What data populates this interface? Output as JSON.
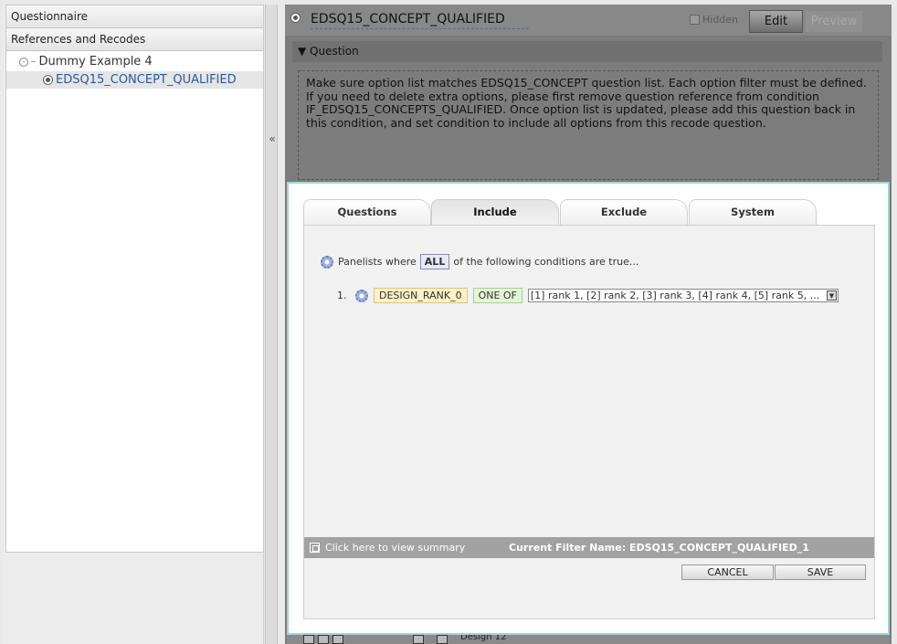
{
  "left_panel": {
    "header1": "Questionnaire",
    "header2": "References and Recodes",
    "tree": {
      "root_label": "Dummy Example 4",
      "child_label": "EDSQ15_CONCEPT_QUALIFIED"
    },
    "collapse_glyph": "«"
  },
  "question": {
    "title": "EDSQ15_CONCEPT_QUALIFIED",
    "hidden_label": "Hidden",
    "edit_label": "Edit",
    "preview_label": "Preview",
    "section_label": "▼ Question",
    "text": "Make sure option list matches EDSQ15_CONCEPT question list. Each option filter must be defined. If you need to delete extra options, please first remove question reference from condition IF_EDSQ15_CONCEPTS_QUALIFIED. Once option list is updated, please add this question back in this condition, and set condition to include all options from this recode question."
  },
  "filter_dialog": {
    "tabs": [
      {
        "label": "Questions",
        "active": false
      },
      {
        "label": "Include",
        "active": true
      },
      {
        "label": "Exclude",
        "active": false
      },
      {
        "label": "System",
        "active": false
      }
    ],
    "cond_prefix": "Panelists where",
    "match_mode": "ALL",
    "cond_suffix": "of the following conditions are true...",
    "conditions": [
      {
        "number": "1.",
        "variable": "DESIGN_RANK_0",
        "operator": "ONE OF",
        "options": "[1] rank 1, [2] rank 2, [3] rank 3, [4] rank 4, [5] rank 5, ..."
      }
    ],
    "summary_link": "Click here to view summary",
    "filter_name": "Current Filter Name: EDSQ15_CONCEPT_QUALIFIED_1",
    "cancel_label": "CANCEL",
    "save_label": "SAVE"
  },
  "bottom_toolbar": {
    "label": "Design 12"
  },
  "colors": {
    "dialog_border": "#a3d3da",
    "link_blue": "#2a5a9b",
    "variable_badge": "#fbf1c6",
    "operator_badge": "#e4f5d8",
    "summary_bar": "#a2a2a2"
  }
}
